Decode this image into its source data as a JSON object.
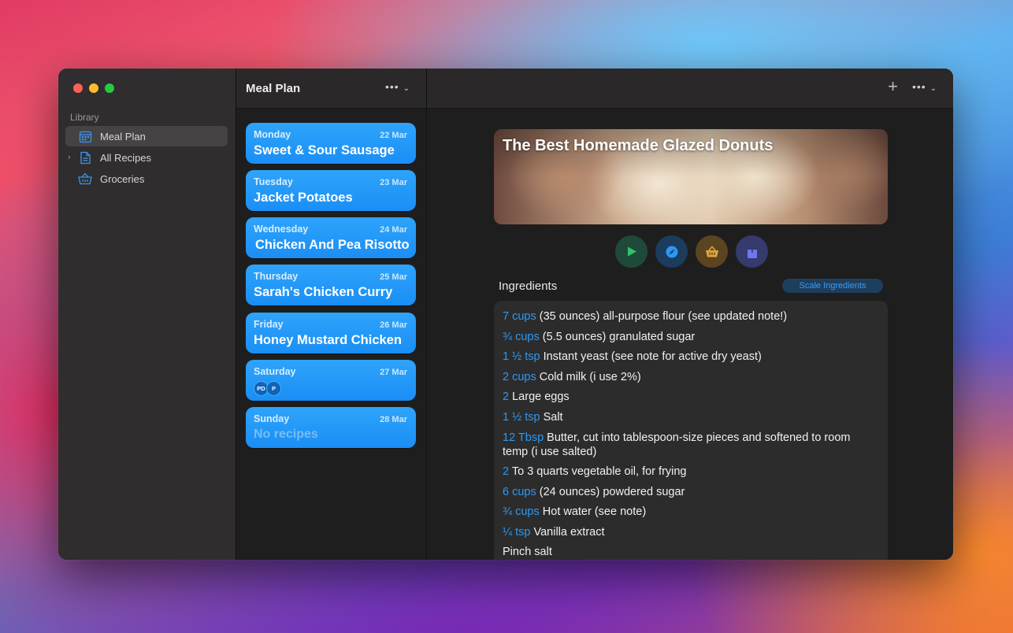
{
  "sidebar": {
    "section_label": "Library",
    "items": [
      {
        "label": "Meal Plan",
        "icon": "calendar-icon",
        "active": true
      },
      {
        "label": "All Recipes",
        "icon": "document-icon",
        "active": false
      },
      {
        "label": "Groceries",
        "icon": "basket-icon",
        "active": false
      }
    ]
  },
  "middle": {
    "title": "Meal Plan",
    "more_label": "•••",
    "days": [
      {
        "day": "Monday",
        "date": "22 Mar",
        "recipe": "Sweet & Sour Sausage"
      },
      {
        "day": "Tuesday",
        "date": "23 Mar",
        "recipe": "Jacket Potatoes"
      },
      {
        "day": "Wednesday",
        "date": "24 Mar",
        "recipe": "Chicken And Pea Risotto"
      },
      {
        "day": "Thursday",
        "date": "25 Mar",
        "recipe": "Sarah's Chicken Curry"
      },
      {
        "day": "Friday",
        "date": "26 Mar",
        "recipe": "Honey Mustard Chicken"
      },
      {
        "day": "Saturday",
        "date": "27 Mar",
        "avatars": [
          "PD",
          "P"
        ]
      },
      {
        "day": "Sunday",
        "date": "28 Mar",
        "empty_label": "No recipes"
      }
    ]
  },
  "detail": {
    "more_label": "•••",
    "recipe_title": "The Best Homemade Glazed Donuts",
    "ingredients_heading": "Ingredients",
    "scale_label": "Scale Ingredients",
    "ingredients": [
      {
        "qty": "7 cups",
        "text": " (35 ounces) all-purpose flour (see updated note!)"
      },
      {
        "qty": "¾ cups",
        "text": " (5.5 ounces) granulated sugar"
      },
      {
        "qty": "1 ½ tsp",
        "text": " Instant yeast (see note for active dry yeast)"
      },
      {
        "qty": "2 cups",
        "text": " Cold milk (i use 2%)"
      },
      {
        "qty": "2",
        "text": " Large eggs"
      },
      {
        "qty": "1 ½ tsp",
        "text": " Salt"
      },
      {
        "qty": "12 Tbsp",
        "text": " Butter, cut into tablespoon-size pieces and softened to room temp (i use salted)"
      },
      {
        "qty": "2",
        "text": " To 3 quarts vegetable oil, for frying"
      },
      {
        "qty": "6 cups",
        "text": " (24 ounces) powdered sugar"
      },
      {
        "qty": "¾ cups",
        "text": " Hot water (see note)"
      },
      {
        "qty": "¼ tsp",
        "text": " Vanilla extract"
      },
      {
        "qty": "",
        "text": "Pinch salt"
      }
    ]
  },
  "colors": {
    "accent": "#2d98f3",
    "card": "#1a8ef5",
    "play": "#2fc46a",
    "basket": "#e0a53a",
    "share": "#6d78f0"
  }
}
